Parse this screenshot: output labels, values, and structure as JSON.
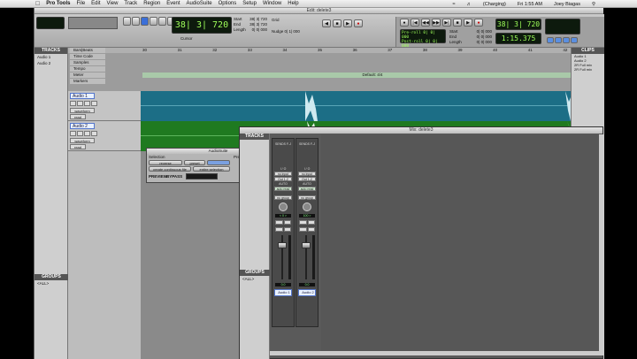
{
  "menubar": {
    "app": "Pro Tools",
    "items": [
      "File",
      "Edit",
      "View",
      "Track",
      "Region",
      "Event",
      "AudioSuite",
      "Options",
      "Setup",
      "Window",
      "Help"
    ],
    "status": [
      "(Charging)",
      "Fri 1:55 AM",
      "Joey Biagas"
    ]
  },
  "edit_window": {
    "title": "Edit: delete3",
    "counter_main": "38| 3| 720",
    "counter_secondary": "1:15.375",
    "selection": {
      "start_label": "Start",
      "end_label": "End",
      "length_label": "Length",
      "start": "38| 3| 720",
      "end": "38| 3| 720",
      "length": "0| 0| 000"
    },
    "nudge_label": "Nudge",
    "nudge_value": "0| 1| 000",
    "cursor_label": "Cursor",
    "grid_label": "Grid",
    "pre_roll": "Pre-roll",
    "post_roll": "Post-roll",
    "transport_start": "Start",
    "transport_end": "End",
    "transport_length": "Length",
    "transport_values": [
      "0| 0| 000",
      "0| 0| 000",
      "0| 0| 000"
    ],
    "rulers": [
      "Bars|Beats",
      "Time Code",
      "Samples",
      "Tempo",
      "Meter",
      "Markers"
    ],
    "ruler_marks": [
      "30",
      "31",
      "32",
      "33",
      "34",
      "35",
      "36",
      "37",
      "38",
      "39",
      "40",
      "41",
      "42",
      "43"
    ],
    "tempo_default": "Default: 4/4",
    "tracks_header": "TRACKS",
    "tracks_list": [
      "Audio 1",
      "Audio 2"
    ],
    "groups_header": "GROUPS",
    "groups_list": [
      "<ALL>"
    ],
    "clips_header": "CLIPS",
    "clips_list": [
      "Audio 1",
      "Audio 2",
      "2R Full mix",
      "2R Full mix"
    ],
    "track1": {
      "name": "Audio 1",
      "view": "waveform",
      "mode": "read"
    },
    "track2": {
      "name": "Audio 2",
      "view": "waveform",
      "mode": "read"
    }
  },
  "audiosuite": {
    "title": "AudioSuite",
    "selection_label": "Selection",
    "preset_label": "Preset",
    "button_reverse": "reverse",
    "button_create": "create continuous file",
    "button_preset": "preset",
    "mode": "entire selection",
    "preview": "PREVIEW",
    "bypass": "BYPASS",
    "process_button": "Process"
  },
  "mix_window": {
    "title": "Mix: delete3",
    "tracks_header": "TRACKS",
    "groups_header": "GROUPS",
    "group_all": "<ALL>",
    "strips": [
      {
        "name": "Audio 1",
        "input": "Input 1",
        "io": "no input",
        "output": "Out 1-2",
        "auto_label": "AUTO",
        "auto": "auto read",
        "group": "no group",
        "pan_left": "pan",
        "pan_val": "< 0 >",
        "vol": "0.0",
        "pan2": "0"
      },
      {
        "name": "Audio 2",
        "input": "Input 2",
        "io": "no input",
        "output": "Out 1-2",
        "auto_label": "AUTO",
        "auto": "auto read",
        "group": "no group",
        "pan_left": "pan",
        "pan_val": "100 >",
        "vol": "0.0",
        "pan2": "0"
      }
    ],
    "sends": "SENDS F-J",
    "io_label": "I / O"
  }
}
